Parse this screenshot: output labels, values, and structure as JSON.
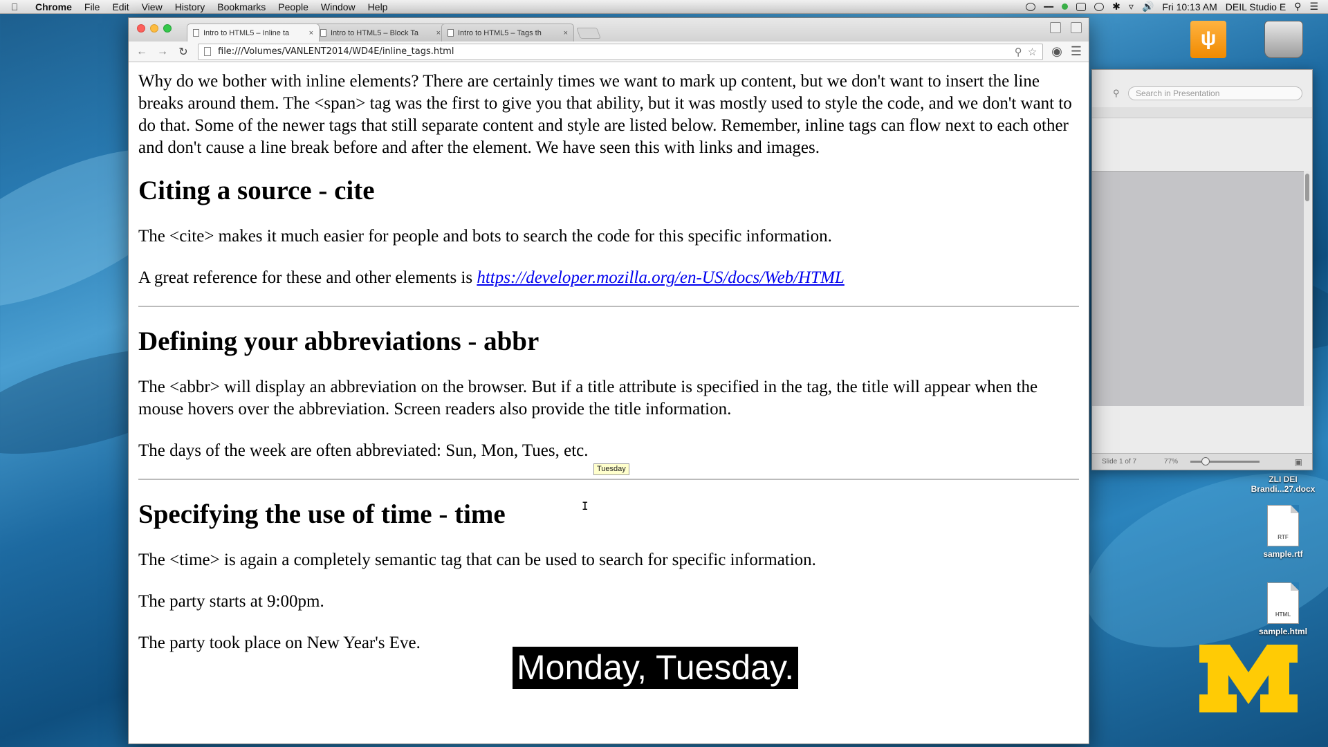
{
  "menubar": {
    "app": "Chrome",
    "items": [
      "File",
      "Edit",
      "View",
      "History",
      "Bookmarks",
      "People",
      "Window",
      "Help"
    ],
    "clock": "Fri 10:13 AM",
    "user": "DEIL Studio E"
  },
  "browser": {
    "tabs": [
      {
        "label": "Intro to HTML5 – Inline ta"
      },
      {
        "label": "Intro to HTML5 – Block Ta"
      },
      {
        "label": "Intro to HTML5 – Tags th"
      }
    ],
    "url": "file:///Volumes/VANLENT2014/WD4E/inline_tags.html"
  },
  "page": {
    "intro": "Why do we bother with inline elements? There are certainly times we want to mark up content, but we don't want to insert the line breaks around them. The <span> tag was the first to give you that ability, but it was mostly used to style the code, and we don't want to do that. Some of the newer tags that still separate content and style are listed below. Remember, inline tags can flow next to each other and don't cause a line break before and after the element. We have seen this with links and images.",
    "cite": {
      "heading": "Citing a source - cite",
      "para1": "The <cite> makes it much easier for people and bots to search the code for this specific information.",
      "para2_prefix": "A great reference for these and other elements is ",
      "link": "https://developer.mozilla.org/en-US/docs/Web/HTML"
    },
    "abbr": {
      "heading": "Defining your abbreviations - abbr",
      "para1": "The <abbr> will display an abbreviation on the browser. But if a title attribute is specified in the tag, the title will appear when the mouse hovers over the abbreviation. Screen readers also provide the title information.",
      "para2": "The days of the week are often abbreviated: Sun, Mon, Tues, etc.",
      "tooltip": "Tuesday"
    },
    "time": {
      "heading": "Specifying the use of time - time",
      "para1": "The <time> is again a completely semantic tag that can be used to search for specific information.",
      "para2": "The party starts at 9:00pm.",
      "para3": "The party took place on New Year's Eve."
    }
  },
  "ppt": {
    "search_placeholder": "Search in Presentation",
    "slide_status": "Slide 1 of 7",
    "zoom": "77%"
  },
  "desktop": {
    "icons": [
      {
        "label": "ZLI DEI Brandi...27.docx"
      },
      {
        "label": "sample.rtf",
        "badge": "RTF"
      },
      {
        "label": "sample.html",
        "badge": "HTML"
      }
    ]
  },
  "subtitle": "Monday, Tuesday."
}
